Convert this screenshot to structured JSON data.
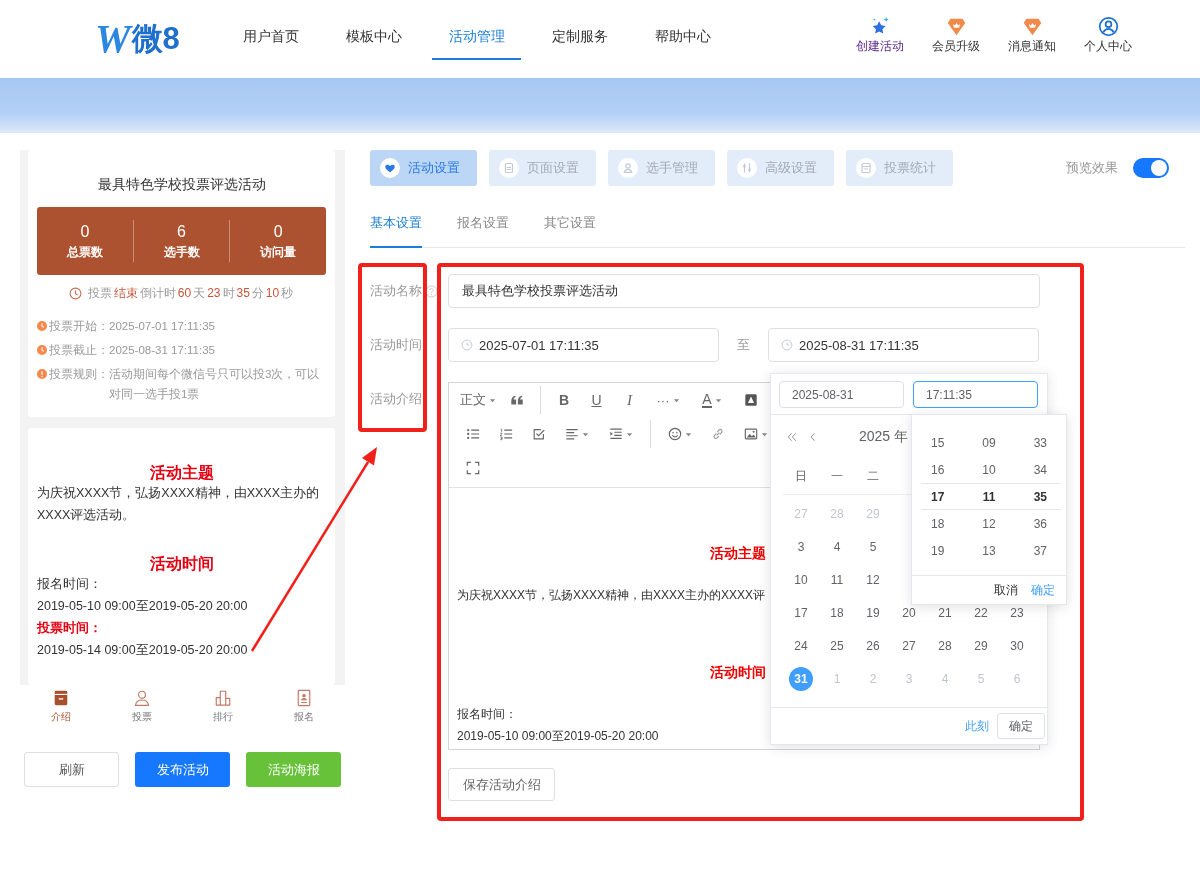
{
  "header": {
    "logo": {
      "mark": "W",
      "text": "微8"
    },
    "nav": [
      {
        "label": "用户首页",
        "selected": false
      },
      {
        "label": "模板中心",
        "selected": false
      },
      {
        "label": "活动管理",
        "selected": true
      },
      {
        "label": "定制服务",
        "selected": false
      },
      {
        "label": "帮助中心",
        "selected": false
      }
    ],
    "actions": [
      {
        "kind": "star",
        "label": "创建活动"
      },
      {
        "kind": "badge",
        "label": "会员升级"
      },
      {
        "kind": "badge",
        "label": "消息通知"
      },
      {
        "kind": "user",
        "label": "个人中心"
      }
    ]
  },
  "preview": {
    "title": "最具特色学校投票评选活动",
    "stats": [
      {
        "value": "0",
        "label": "总票数"
      },
      {
        "value": "6",
        "label": "选手数"
      },
      {
        "value": "0",
        "label": "访问量"
      }
    ],
    "countdown": [
      {
        "text": "投票",
        "highlight": false
      },
      {
        "text": "结束",
        "highlight": true
      },
      {
        "text": "倒计时",
        "highlight": false
      },
      {
        "text": "60",
        "highlight": true
      },
      {
        "text": "天",
        "highlight": false
      },
      {
        "text": "23",
        "highlight": true
      },
      {
        "text": "时",
        "highlight": false
      },
      {
        "text": "35",
        "highlight": true
      },
      {
        "text": "分",
        "highlight": false
      },
      {
        "text": "10",
        "highlight": true
      },
      {
        "text": "秒",
        "highlight": false
      }
    ],
    "info": [
      {
        "kind": "clock",
        "label": "投票开始：",
        "value": "2025-07-01 17:11:35"
      },
      {
        "kind": "clock",
        "label": "投票截止：",
        "value": "2025-08-31 17:11:35"
      },
      {
        "kind": "alert",
        "label": "投票规则：",
        "value": "活动期间每个微信号只可以投3次，可以对同一选手投1票"
      }
    ],
    "content": [
      {
        "kind": "heading",
        "text": "活动主题"
      },
      {
        "kind": "paragraph",
        "text": "为庆祝XXXX节，弘扬XXXX精神，由XXXX主办的XXXX评选活动。"
      },
      {
        "kind": "heading",
        "text": "活动时间"
      },
      {
        "kind": "paragraph",
        "text": "报名时间："
      },
      {
        "kind": "paragraph",
        "text": "2019-05-10 09:00至2019-05-20 20:00"
      },
      {
        "kind": "label",
        "text": "投票时间："
      },
      {
        "kind": "paragraph",
        "text": "2019-05-14 09:00至2019-05-20 20:00"
      }
    ],
    "tabbar": [
      {
        "kind": "intro",
        "label": "介绍",
        "selected": true
      },
      {
        "kind": "vote",
        "label": "投票",
        "selected": false
      },
      {
        "kind": "rank",
        "label": "排行",
        "selected": false
      },
      {
        "kind": "signup",
        "label": "报名",
        "selected": false
      }
    ]
  },
  "buttons": [
    {
      "kind": "default",
      "label": "刷新"
    },
    {
      "kind": "primary",
      "label": "发布活动"
    },
    {
      "kind": "success",
      "label": "活动海报"
    }
  ],
  "settings": {
    "tabs": [
      {
        "kind": "heart",
        "label": "活动设置",
        "selected": true
      },
      {
        "kind": "page",
        "label": "页面设置",
        "selected": false
      },
      {
        "kind": "person",
        "label": "选手管理",
        "selected": false
      },
      {
        "kind": "sliders",
        "label": "高级设置",
        "selected": false
      },
      {
        "kind": "table",
        "label": "投票统计",
        "selected": false
      }
    ],
    "preview_toggle": {
      "label": "预览效果",
      "on": true
    },
    "subtabs": [
      {
        "label": "基本设置",
        "selected": true
      },
      {
        "label": "报名设置",
        "selected": false
      },
      {
        "label": "其它设置",
        "selected": false
      }
    ],
    "form": {
      "name": {
        "label": "活动名称",
        "value": "最具特色学校投票评选活动"
      },
      "time": {
        "label": "活动时间",
        "start": "2025-07-01 17:11:35",
        "separator": "至",
        "end": "2025-08-31 17:11:35"
      },
      "intro": {
        "label": "活动介绍",
        "toolbar": [
          [
            {
              "kind": "text",
              "text": "正文",
              "dropdown": true,
              "separator": false
            },
            {
              "kind": "quote",
              "dropdown": false,
              "separator": false
            },
            {
              "kind": "bold",
              "text": "B",
              "dropdown": false,
              "separator": true
            },
            {
              "kind": "underline",
              "text": "U",
              "dropdown": false,
              "separator": false
            },
            {
              "kind": "italic",
              "text": "I",
              "dropdown": false,
              "separator": false
            },
            {
              "kind": "more",
              "text": "···",
              "dropdown": true,
              "separator": false
            },
            {
              "kind": "color",
              "text": "A",
              "dropdown": true,
              "separator": false
            },
            {
              "kind": "highlight",
              "dropdown": false,
              "separator": false
            }
          ],
          [
            {
              "kind": "bullets",
              "dropdown": false,
              "separator": false
            },
            {
              "kind": "numbers",
              "dropdown": false,
              "separator": false
            },
            {
              "kind": "todo",
              "dropdown": false,
              "separator": false
            },
            {
              "kind": "align",
              "dropdown": true,
              "separator": false
            },
            {
              "kind": "indent",
              "dropdown": true,
              "separator": false
            },
            {
              "kind": "emoji",
              "dropdown": true,
              "separator": true
            },
            {
              "kind": "link",
              "dropdown": false,
              "separator": false
            },
            {
              "kind": "image",
              "dropdown": true,
              "separator": false
            }
          ],
          [
            {
              "kind": "fullscreen",
              "dropdown": false,
              "separator": false
            }
          ]
        ],
        "content": [
          {
            "kind": "heading",
            "text": "活动主题"
          },
          {
            "kind": "paragraph",
            "text": "为庆祝XXXX节，弘扬XXXX精神，由XXXX主办的XXXX评"
          },
          {
            "kind": "heading",
            "text": "活动时间"
          },
          {
            "kind": "paragraph",
            "text": "报名时间："
          },
          {
            "kind": "paragraph",
            "text": "2019-05-10 09:00至2019-05-20 20:00"
          }
        ],
        "save_button": "保存活动介绍"
      }
    }
  },
  "date_picker": {
    "date_input": {
      "value": "2025-08-31",
      "focused": false
    },
    "time_input": {
      "value": "17:11:35",
      "focused": true
    },
    "title": "2025 年",
    "weekdays": [
      "日",
      "一",
      "二"
    ],
    "weeks": [
      [
        {
          "day": "27",
          "other_month": true,
          "selected": false
        },
        {
          "day": "28",
          "other_month": true,
          "selected": false
        },
        {
          "day": "29",
          "other_month": true,
          "selected": false
        }
      ],
      [
        {
          "day": "3",
          "other_month": false,
          "selected": false
        },
        {
          "day": "4",
          "other_month": false,
          "selected": false
        },
        {
          "day": "5",
          "other_month": false,
          "selected": false
        }
      ],
      [
        {
          "day": "10",
          "other_month": false,
          "selected": false
        },
        {
          "day": "11",
          "other_month": false,
          "selected": false
        },
        {
          "day": "12",
          "other_month": false,
          "selected": false
        }
      ],
      [
        {
          "day": "17",
          "other_month": false,
          "selected": false
        },
        {
          "day": "18",
          "other_month": false,
          "selected": false
        },
        {
          "day": "19",
          "other_month": false,
          "selected": false
        },
        {
          "day": "20",
          "other_month": false,
          "selected": false
        },
        {
          "day": "21",
          "other_month": false,
          "selected": false
        },
        {
          "day": "22",
          "other_month": false,
          "selected": false
        },
        {
          "day": "23",
          "other_month": false,
          "selected": false
        }
      ],
      [
        {
          "day": "24",
          "other_month": false,
          "selected": false
        },
        {
          "day": "25",
          "other_month": false,
          "selected": false
        },
        {
          "day": "26",
          "other_month": false,
          "selected": false
        },
        {
          "day": "27",
          "other_month": false,
          "selected": false
        },
        {
          "day": "28",
          "other_month": false,
          "selected": false
        },
        {
          "day": "29",
          "other_month": false,
          "selected": false
        },
        {
          "day": "30",
          "other_month": false,
          "selected": false
        }
      ],
      [
        {
          "day": "31",
          "other_month": false,
          "selected": true
        },
        {
          "day": "1",
          "other_month": true,
          "selected": false
        },
        {
          "day": "2",
          "other_month": true,
          "selected": false
        },
        {
          "day": "3",
          "other_month": true,
          "selected": false
        },
        {
          "day": "4",
          "other_month": true,
          "selected": false
        },
        {
          "day": "5",
          "other_month": true,
          "selected": false
        },
        {
          "day": "6",
          "other_month": true,
          "selected": false
        }
      ]
    ],
    "now_link": "此刻",
    "confirm_button": "确定",
    "time_panel": {
      "columns": [
        [
          {
            "value": "15",
            "selected": false
          },
          {
            "value": "16",
            "selected": false
          },
          {
            "value": "17",
            "selected": true
          },
          {
            "value": "18",
            "selected": false
          },
          {
            "value": "19",
            "selected": false
          }
        ],
        [
          {
            "value": "09",
            "selected": false
          },
          {
            "value": "10",
            "selected": false
          },
          {
            "value": "11",
            "selected": true
          },
          {
            "value": "12",
            "selected": false
          },
          {
            "value": "13",
            "selected": false
          }
        ],
        [
          {
            "value": "33",
            "selected": false
          },
          {
            "value": "34",
            "selected": false
          },
          {
            "value": "35",
            "selected": true
          },
          {
            "value": "36",
            "selected": false
          },
          {
            "value": "37",
            "selected": false
          }
        ]
      ],
      "cancel": "取消",
      "confirm": "确定"
    }
  },
  "annotations": {
    "label_frame": true,
    "field_frame": true,
    "arrow": true
  }
}
